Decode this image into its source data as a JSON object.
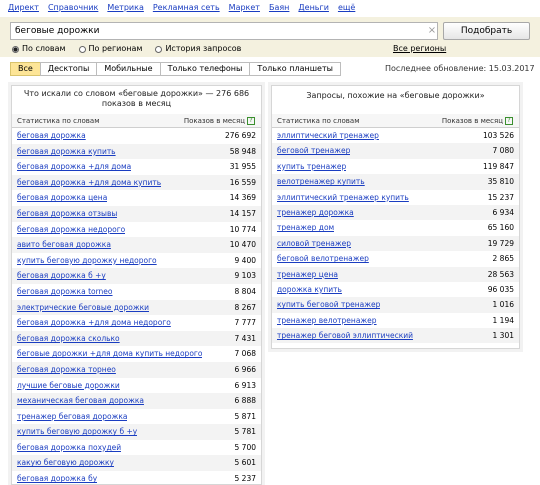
{
  "topnav": [
    "Директ",
    "Справочник",
    "Метрика",
    "Рекламная сеть",
    "Маркет",
    "Баян",
    "Деньги",
    "ещё"
  ],
  "search": {
    "value": "беговые дорожки",
    "clear": "×",
    "button": "Подобрать"
  },
  "radios": [
    {
      "label": "По словам",
      "selected": true
    },
    {
      "label": "По регионам",
      "selected": false
    },
    {
      "label": "История запросов",
      "selected": false
    }
  ],
  "all_regions": "Все регионы",
  "device_tabs": [
    {
      "label": "Все",
      "active": true
    },
    {
      "label": "Десктопы",
      "active": false
    },
    {
      "label": "Мобильные",
      "active": false
    },
    {
      "label": "Только телефоны",
      "active": false
    },
    {
      "label": "Только планшеты",
      "active": false
    }
  ],
  "last_updated": "Последнее обновление: 15.03.2017",
  "left_panel": {
    "title": "Что искали со словом «беговые дорожки» — 276 686 показов в месяц",
    "col_words": "Статистика по словам",
    "col_shows": "Показов в месяц",
    "help": "?",
    "rows": [
      [
        "беговая дорожка",
        "276 692"
      ],
      [
        "беговая дорожка купить",
        "58 948"
      ],
      [
        "беговая дорожка +для дома",
        "31 955"
      ],
      [
        "беговая дорожка +для дома купить",
        "16 559"
      ],
      [
        "беговая дорожка цена",
        "14 369"
      ],
      [
        "беговая дорожка отзывы",
        "14 157"
      ],
      [
        "беговая дорожка недорого",
        "10 774"
      ],
      [
        "авито беговая дорожка",
        "10 470"
      ],
      [
        "купить беговую дорожку недорого",
        "9 400"
      ],
      [
        "беговая дорожка б +у",
        "9 103"
      ],
      [
        "беговая дорожка torneo",
        "8 804"
      ],
      [
        "электрические беговые дорожки",
        "8 267"
      ],
      [
        "беговая дорожка +для дома недорого",
        "7 777"
      ],
      [
        "беговая дорожка сколько",
        "7 431"
      ],
      [
        "беговые дорожки +для дома купить недорого",
        "7 068"
      ],
      [
        "беговая дорожка торнео",
        "6 966"
      ],
      [
        "лучшие беговые дорожки",
        "6 913"
      ],
      [
        "механическая беговая дорожка",
        "6 888"
      ],
      [
        "тренажер беговая дорожка",
        "5 871"
      ],
      [
        "купить беговую дорожку б +у",
        "5 781"
      ],
      [
        "беговая дорожка похудей",
        "5 700"
      ],
      [
        "какую беговую дорожку",
        "5 601"
      ],
      [
        "беговая дорожка бу",
        "5 237"
      ]
    ]
  },
  "right_panel": {
    "title": "Запросы, похожие на «беговые дорожки»",
    "col_words": "Статистика по словам",
    "col_shows": "Показов в месяц",
    "help": "?",
    "rows": [
      [
        "эллиптический тренажер",
        "103 526"
      ],
      [
        "беговой тренажер",
        "7 080"
      ],
      [
        "купить тренажер",
        "119 847"
      ],
      [
        "велотренажер купить",
        "35 810"
      ],
      [
        "эллиптический тренажер купить",
        "15 237"
      ],
      [
        "тренажер дорожка",
        "6 934"
      ],
      [
        "тренажер дом",
        "65 160"
      ],
      [
        "силовой тренажер",
        "19 729"
      ],
      [
        "беговой велотренажер",
        "2 865"
      ],
      [
        "тренажер цена",
        "28 563"
      ],
      [
        "дорожка купить",
        "96 035"
      ],
      [
        "купить беговой тренажер",
        "1 016"
      ],
      [
        "тренажер велотренажер",
        "1 194"
      ],
      [
        "тренажер беговой эллиптический",
        "1 301"
      ]
    ]
  }
}
